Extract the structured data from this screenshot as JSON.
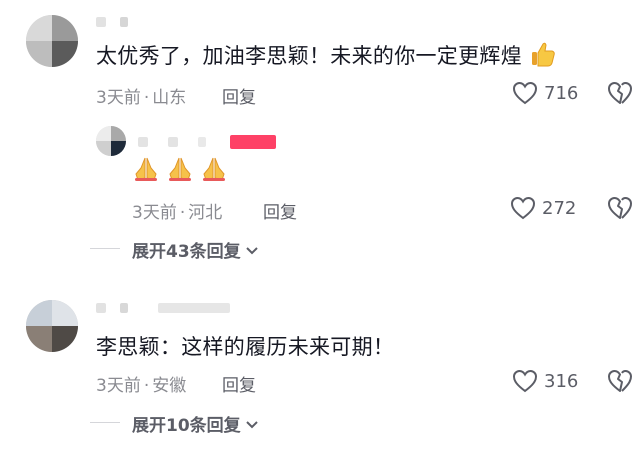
{
  "comments": [
    {
      "text": "太优秀了，加油李思颖！未来的你一定更辉煌",
      "time": "3天前",
      "location": "山东",
      "reply_label": "回复",
      "likes": "716",
      "reply": {
        "text": "🙏🙏🙏",
        "time": "3天前",
        "location": "河北",
        "reply_label": "回复",
        "likes": "272"
      },
      "expand_label": "展开43条回复"
    },
    {
      "text": "李思颖：这样的履历未来可期！",
      "time": "3天前",
      "location": "安徽",
      "reply_label": "回复",
      "likes": "316",
      "expand_label": "展开10条回复"
    }
  ],
  "meta_separator": "·",
  "colors": {
    "text": "#161823",
    "meta": "#8a8b91",
    "secondary": "#5b5d66",
    "author_tag": "#fe2c55"
  }
}
